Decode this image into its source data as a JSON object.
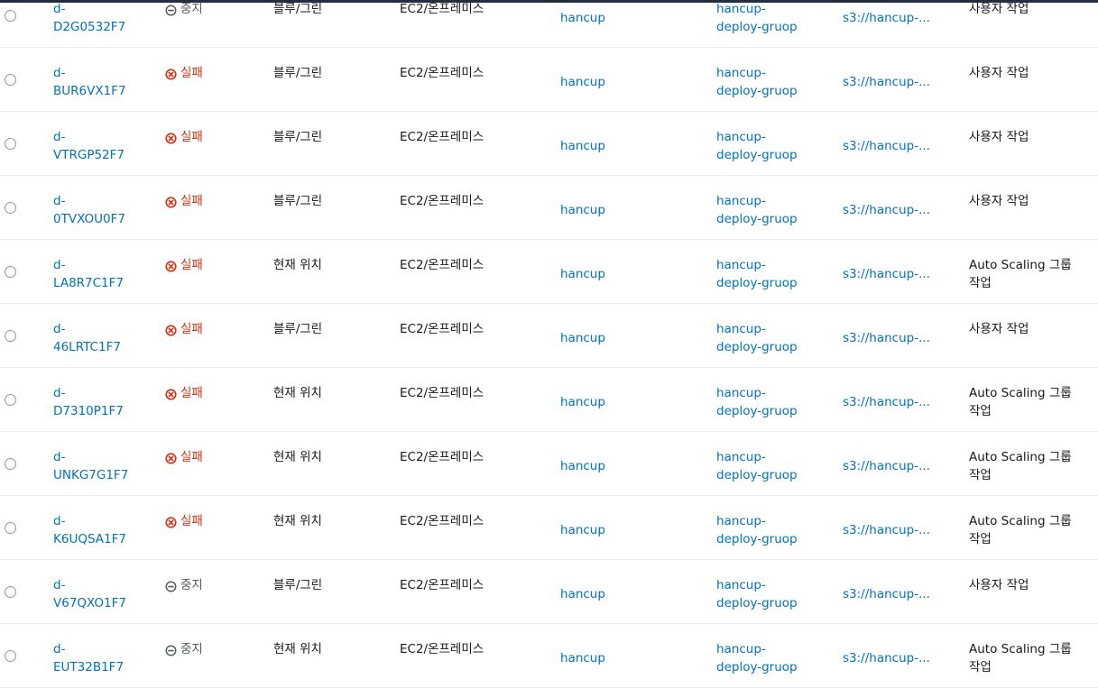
{
  "rows": [
    {
      "id_prefix": "d-",
      "id_suffix": "D2G0532F7",
      "status": "중지",
      "status_type": "stopped",
      "type": "블루/그린",
      "platform": "EC2/온프레미스",
      "app": "hancup",
      "group_line1": "hancup-",
      "group_line2": "deploy-gruop",
      "revision": "s3://hancup-...",
      "initiator": "사용자 작업"
    },
    {
      "id_prefix": "d-",
      "id_suffix": "BUR6VX1F7",
      "status": "실패",
      "status_type": "failed",
      "type": "블루/그린",
      "platform": "EC2/온프레미스",
      "app": "hancup",
      "group_line1": "hancup-",
      "group_line2": "deploy-gruop",
      "revision": "s3://hancup-...",
      "initiator": "사용자 작업"
    },
    {
      "id_prefix": "d-",
      "id_suffix": "VTRGP52F7",
      "status": "실패",
      "status_type": "failed",
      "type": "블루/그린",
      "platform": "EC2/온프레미스",
      "app": "hancup",
      "group_line1": "hancup-",
      "group_line2": "deploy-gruop",
      "revision": "s3://hancup-...",
      "initiator": "사용자 작업"
    },
    {
      "id_prefix": "d-",
      "id_suffix": "0TVXOU0F7",
      "status": "실패",
      "status_type": "failed",
      "type": "블루/그린",
      "platform": "EC2/온프레미스",
      "app": "hancup",
      "group_line1": "hancup-",
      "group_line2": "deploy-gruop",
      "revision": "s3://hancup-...",
      "initiator": "사용자 작업"
    },
    {
      "id_prefix": "d-",
      "id_suffix": "LA8R7C1F7",
      "status": "실패",
      "status_type": "failed",
      "type": "현재 위치",
      "platform": "EC2/온프레미스",
      "app": "hancup",
      "group_line1": "hancup-",
      "group_line2": "deploy-gruop",
      "revision": "s3://hancup-...",
      "initiator": "Auto Scaling 그룹 작업"
    },
    {
      "id_prefix": "d-",
      "id_suffix": "46LRTC1F7",
      "status": "실패",
      "status_type": "failed",
      "type": "블루/그린",
      "platform": "EC2/온프레미스",
      "app": "hancup",
      "group_line1": "hancup-",
      "group_line2": "deploy-gruop",
      "revision": "s3://hancup-...",
      "initiator": "사용자 작업"
    },
    {
      "id_prefix": "d-",
      "id_suffix": "D7310P1F7",
      "status": "실패",
      "status_type": "failed",
      "type": "현재 위치",
      "platform": "EC2/온프레미스",
      "app": "hancup",
      "group_line1": "hancup-",
      "group_line2": "deploy-gruop",
      "revision": "s3://hancup-...",
      "initiator": "Auto Scaling 그룹 작업"
    },
    {
      "id_prefix": "d-",
      "id_suffix": "UNKG7G1F7",
      "status": "실패",
      "status_type": "failed",
      "type": "현재 위치",
      "platform": "EC2/온프레미스",
      "app": "hancup",
      "group_line1": "hancup-",
      "group_line2": "deploy-gruop",
      "revision": "s3://hancup-...",
      "initiator": "Auto Scaling 그룹 작업"
    },
    {
      "id_prefix": "d-",
      "id_suffix": "K6UQSA1F7",
      "status": "실패",
      "status_type": "failed",
      "type": "현재 위치",
      "platform": "EC2/온프레미스",
      "app": "hancup",
      "group_line1": "hancup-",
      "group_line2": "deploy-gruop",
      "revision": "s3://hancup-...",
      "initiator": "Auto Scaling 그룹 작업"
    },
    {
      "id_prefix": "d-",
      "id_suffix": "V67QXO1F7",
      "status": "중지",
      "status_type": "stopped",
      "type": "블루/그린",
      "platform": "EC2/온프레미스",
      "app": "hancup",
      "group_line1": "hancup-",
      "group_line2": "deploy-gruop",
      "revision": "s3://hancup-...",
      "initiator": "사용자 작업"
    },
    {
      "id_prefix": "d-",
      "id_suffix": "EUT32B1F7",
      "status": "중지",
      "status_type": "stopped",
      "type": "현재 위치",
      "platform": "EC2/온프레미스",
      "app": "hancup",
      "group_line1": "hancup-",
      "group_line2": "deploy-gruop",
      "revision": "s3://hancup-...",
      "initiator": "Auto Scaling 그룹 작업"
    }
  ],
  "icons": {
    "failed": "x-circle-icon",
    "stopped": "minus-circle-icon"
  },
  "colors": {
    "failed": "#d13212",
    "stopped": "#545b64",
    "link": "#0073bb"
  }
}
